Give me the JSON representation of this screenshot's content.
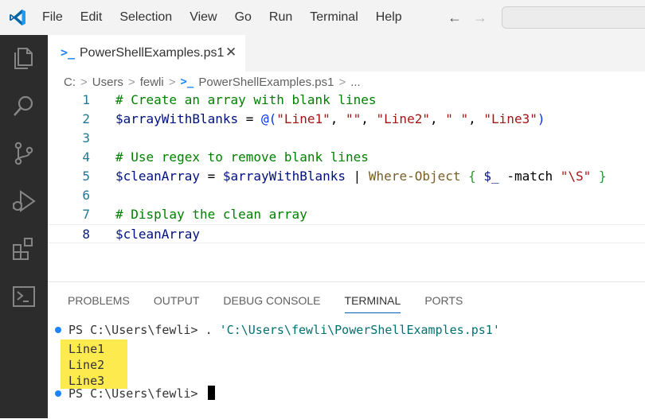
{
  "menu": [
    "File",
    "Edit",
    "Selection",
    "View",
    "Go",
    "Run",
    "Terminal",
    "Help"
  ],
  "nav": {
    "back": "←",
    "forward": "→"
  },
  "tab": {
    "icon_glyph": ">_",
    "label": "PowerShellExamples.ps1",
    "close": "✕"
  },
  "breadcrumb": {
    "parts": [
      "C:",
      "Users",
      "fewli"
    ],
    "file": "PowerShellExamples.ps1",
    "ellipsis": "...",
    "sep": ">"
  },
  "editor": {
    "lines": [
      {
        "number": "1",
        "tokens": [
          {
            "t": "# Create an array with blank lines",
            "c": "comment"
          }
        ]
      },
      {
        "number": "2",
        "tokens": [
          {
            "t": "$arrayWithBlanks",
            "c": "var"
          },
          {
            "t": " = ",
            "c": "op"
          },
          {
            "t": "@(",
            "c": "paren"
          },
          {
            "t": "\"Line1\"",
            "c": "str"
          },
          {
            "t": ", ",
            "c": "op"
          },
          {
            "t": "\"\"",
            "c": "str"
          },
          {
            "t": ", ",
            "c": "op"
          },
          {
            "t": "\"Line2\"",
            "c": "str"
          },
          {
            "t": ", ",
            "c": "op"
          },
          {
            "t": "\" \"",
            "c": "str"
          },
          {
            "t": ", ",
            "c": "op"
          },
          {
            "t": "\"Line3\"",
            "c": "str"
          },
          {
            "t": ")",
            "c": "paren"
          }
        ]
      },
      {
        "number": "3",
        "tokens": []
      },
      {
        "number": "4",
        "tokens": [
          {
            "t": "# Use regex to remove blank lines",
            "c": "comment"
          }
        ]
      },
      {
        "number": "5",
        "tokens": [
          {
            "t": "$cleanArray",
            "c": "var"
          },
          {
            "t": " = ",
            "c": "op"
          },
          {
            "t": "$arrayWithBlanks",
            "c": "var"
          },
          {
            "t": " | ",
            "c": "op"
          },
          {
            "t": "Where-Object",
            "c": "cmd"
          },
          {
            "t": " ",
            "c": "op"
          },
          {
            "t": "{",
            "c": "brace"
          },
          {
            "t": " ",
            "c": "op"
          },
          {
            "t": "$_",
            "c": "var"
          },
          {
            "t": " -match ",
            "c": "param"
          },
          {
            "t": "\"\\S\"",
            "c": "str"
          },
          {
            "t": " ",
            "c": "op"
          },
          {
            "t": "}",
            "c": "brace"
          }
        ]
      },
      {
        "number": "6",
        "tokens": []
      },
      {
        "number": "7",
        "tokens": [
          {
            "t": "# Display the clean array",
            "c": "comment"
          }
        ]
      },
      {
        "number": "8",
        "tokens": [
          {
            "t": "$cleanArray",
            "c": "var"
          }
        ],
        "current": true
      }
    ]
  },
  "panel": {
    "tabs": [
      "PROBLEMS",
      "OUTPUT",
      "DEBUG CONSOLE",
      "TERMINAL",
      "PORTS"
    ],
    "active_tab": "TERMINAL"
  },
  "terminal": {
    "prompt1": "PS C:\\Users\\fewli> ",
    "command_dot": ". ",
    "command_path": "'C:\\Users\\fewli\\PowerShellExamples.ps1'",
    "output": [
      "Line1",
      "Line2",
      "Line3"
    ],
    "prompt2": "PS C:\\Users\\fewli> "
  },
  "colors": {
    "activity_bar": "#2c2c2c",
    "accent": "#005fb8",
    "highlight": "#fdea4f",
    "comment": "#008000",
    "string": "#a31515",
    "variable": "#001080"
  }
}
